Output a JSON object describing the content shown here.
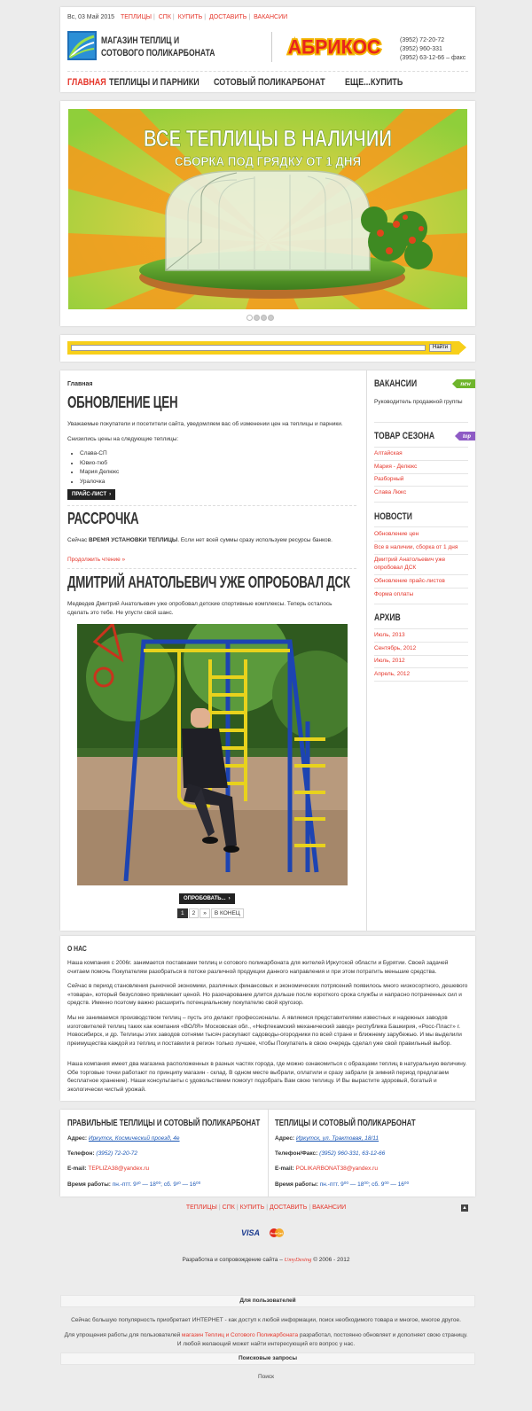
{
  "header": {
    "date": "Вс, 03 Май 2015",
    "top_links": [
      "ТЕПЛИЦЫ",
      "СПК",
      "КУПИТЬ",
      "ДОСТАВИТЬ",
      "ВАКАНСИИ"
    ],
    "logo_line1": "МАГАЗИН ТЕПЛИЦ И",
    "logo_line2": "СОТОВОГО ПОЛИКАРБОНАТА",
    "brand": "АБРИКОС",
    "phone1": "(3952) 72-20-72",
    "phone2": "(3952) 960-331",
    "phone3": "(3952) 63-12-66 – факс",
    "nav": [
      "ГЛАВНАЯ",
      "ТЕПЛИЦЫ И ПАРНИКИ",
      "СОТОВЫЙ ПОЛИКАРБОНАТ",
      "ЕЩЕ...",
      "КУПИТЬ"
    ]
  },
  "banner": {
    "line1": "ВСЕ ТЕПЛИЦЫ В НАЛИЧИИ",
    "line2": "СБОРКА ПОД ГРЯДКУ ОТ 1 ДНЯ",
    "slides": 4,
    "active_slide": 1
  },
  "search": {
    "button": "Найти",
    "placeholder": ""
  },
  "content": {
    "breadcrumb": "Главная",
    "article1": {
      "title": "ОБНОВЛЕНИЕ ЦЕН",
      "p1": "Уважаемые покупатели и посетители сайта, уведомляем вас об изменении цен на теплицы и парники.",
      "p2": "Снизились цены на следующие теплицы:",
      "items": [
        "Слава-СП",
        "Ювио-тюб",
        "Мария Делюкс",
        "Уралочка"
      ],
      "button": "ПРАЙС-ЛИСТ"
    },
    "article2": {
      "title": "РАССРОЧКА",
      "p_pre": "Сейчас ",
      "p_bold": "ВРЕМЯ УСТАНОВКИ ТЕПЛИЦЫ",
      "p_post": ". Если нет всей суммы сразу используем ресурсы банков.",
      "more": "Продолжить чтение »"
    },
    "article3": {
      "title": "ДМИТРИЙ АНАТОЛЬЕВИЧ УЖЕ ОПРОБОВАЛ ДСК",
      "p": "Медведев Дмитрий Анатольевич уже опробовал детские спортивные комплексы. Теперь осталось сделать это тебе. Не упусти свой шанс.",
      "button": "ОПРОБОВАТЬ..."
    },
    "pager": [
      "1",
      "2",
      "»",
      "В КОНЕЦ"
    ]
  },
  "sidebar": {
    "vacancies": {
      "title": "ВАКАНСИИ",
      "tag": "new",
      "text": "Руководитель продажной группы"
    },
    "season": {
      "title": "ТОВАР СЕЗОНА",
      "tag": "top",
      "items": [
        "Алтайская",
        "Мария - Делюкс",
        "Разборный",
        "Слава Люкс"
      ]
    },
    "news": {
      "title": "НОВОСТИ",
      "items": [
        "Обновление цен",
        "Все в наличии, сборка от 1 дня",
        "Дмитрий Анатольевич уже опробовал ДСК",
        "Обновление прайс-листов",
        "Форма оплаты"
      ]
    },
    "archive": {
      "title": "АРХИВ",
      "items": [
        "Июль, 2013",
        "Сентябрь, 2012",
        "Июль, 2012",
        "Апрель, 2012"
      ]
    }
  },
  "about": {
    "title": "О НАС",
    "p1": "Наша компания с 2006г. занимается поставками теплиц и сотового поликарбоната для жителей Иркутской области и Бурятии. Своей задачей считаем помочь Покупателям разобраться в потоке различной продукции данного направления и при этом потратить меньшие средства.",
    "p2": "Сейчас в период становления рыночной экономики, различных финансовых и экономических потрясений появилось много низкосортного, дешевого «товара», который безусловно привлекает ценой. Но разочарование длится дольше после короткого срока службы и напрасно потраченных сил и средств. Именно поэтому важно расширить потенциальному покупателю свой кругозор.",
    "p3": "Мы не занимаемся производством теплиц – пусть это делают профессионалы. А являемся представителями известных и надежных заводов изготовителей теплиц таких как компания «ВОЛЯ» Московская обл., «Нефтекамский механический завод» республика Башкирия, «Росс-Пласт» г. Новосибирск, и др. Теплицы этих заводов сотнями тысяч раскупают садоводы-огородники по всей стране и ближнему зарубежью. И мы выделили преимущества каждой из теплиц и поставили в регион только лучшее, чтобы Покупатель в свою очередь сделал уже свой правильный выбор.",
    "p4": "Наша компания имеет два магазина расположенных в разных частях города, где можно ознакомиться с образцами теплиц в натуральную величину. Обе торговые точки работают по принципу магазин - склад. В одном месте выбрали, оплатили и сразу забрали (в зимний период предлагаем бесплатное хранение). Наши консультанты с удовольствием помогут подобрать Вам свою теплицу. И Вы вырастите здоровый, богатый и экологически чистый урожай."
  },
  "contacts": [
    {
      "title": "ПРАВИЛЬНЫЕ ТЕПЛИЦЫ И СОТОВЫЙ ПОЛИКАРБОНАТ",
      "address_label": "Адрес:",
      "address": "Иркутск, Космический проезд, 4е",
      "phone_label": "Телефон:",
      "phone": "(3952) 72-20-72",
      "email_label": "E-mail:",
      "email": "TEPLIZA38@yandex.ru",
      "hours_label": "Время работы:",
      "hours": "пн.-птт. 9³⁰ — 18⁰⁰; сб. 9³⁰ — 16⁰⁰"
    },
    {
      "title": "ТЕПЛИЦЫ И СОТОВЫЙ ПОЛИКАРБОНАТ",
      "address_label": "Адрес:",
      "address": "Иркутск, ул. Трактовая, 18/11",
      "phone_label": "Телефон/Факс:",
      "phone": "(3952) 960-331, 63-12-66",
      "email_label": "E-mail:",
      "email": "POLIKARBONAT38@yandex.ru",
      "hours_label": "Время работы:",
      "hours": "пн.-птт. 9⁰⁰ — 18⁰⁰; сб. 9⁰⁰ — 16⁰⁰"
    }
  ],
  "footer": {
    "links": [
      "ТЕПЛИЦЫ",
      "СПК",
      "КУПИТЬ",
      "ДОСТАВИТЬ",
      "ВАКАНСИИ"
    ],
    "cards": [
      "VISA",
      "MasterCard"
    ],
    "dev_pre": "Разработка и сопровождение сайта –",
    "dev_sig": "UmyDesing",
    "dev_post": "© 2006 - 2012",
    "users_title": "Для пользователей",
    "users_p1": "Сейчас большую популярность приобретает ИНТЕРНЕТ - как доступ к любой информации, поиск необходимого товара и многое, многое другое.",
    "users_p2_pre": "Для упрощения работы для пользователей",
    "users_p2_link": "магазин Теплиц и Сотового Поликарбоната",
    "users_p2_post": "разработал, постоянно обновляет и дополняет свою страницу. И любой желающий может найти интересующий его вопрос у нас.",
    "queries_title": "Поисковые запросы",
    "search_label": "Поиск"
  },
  "colors": {
    "accent": "#e5352a",
    "search_bar": "#f7cf1a",
    "tag_new": "#6fb52c",
    "tag_top": "#8e5bc5"
  }
}
